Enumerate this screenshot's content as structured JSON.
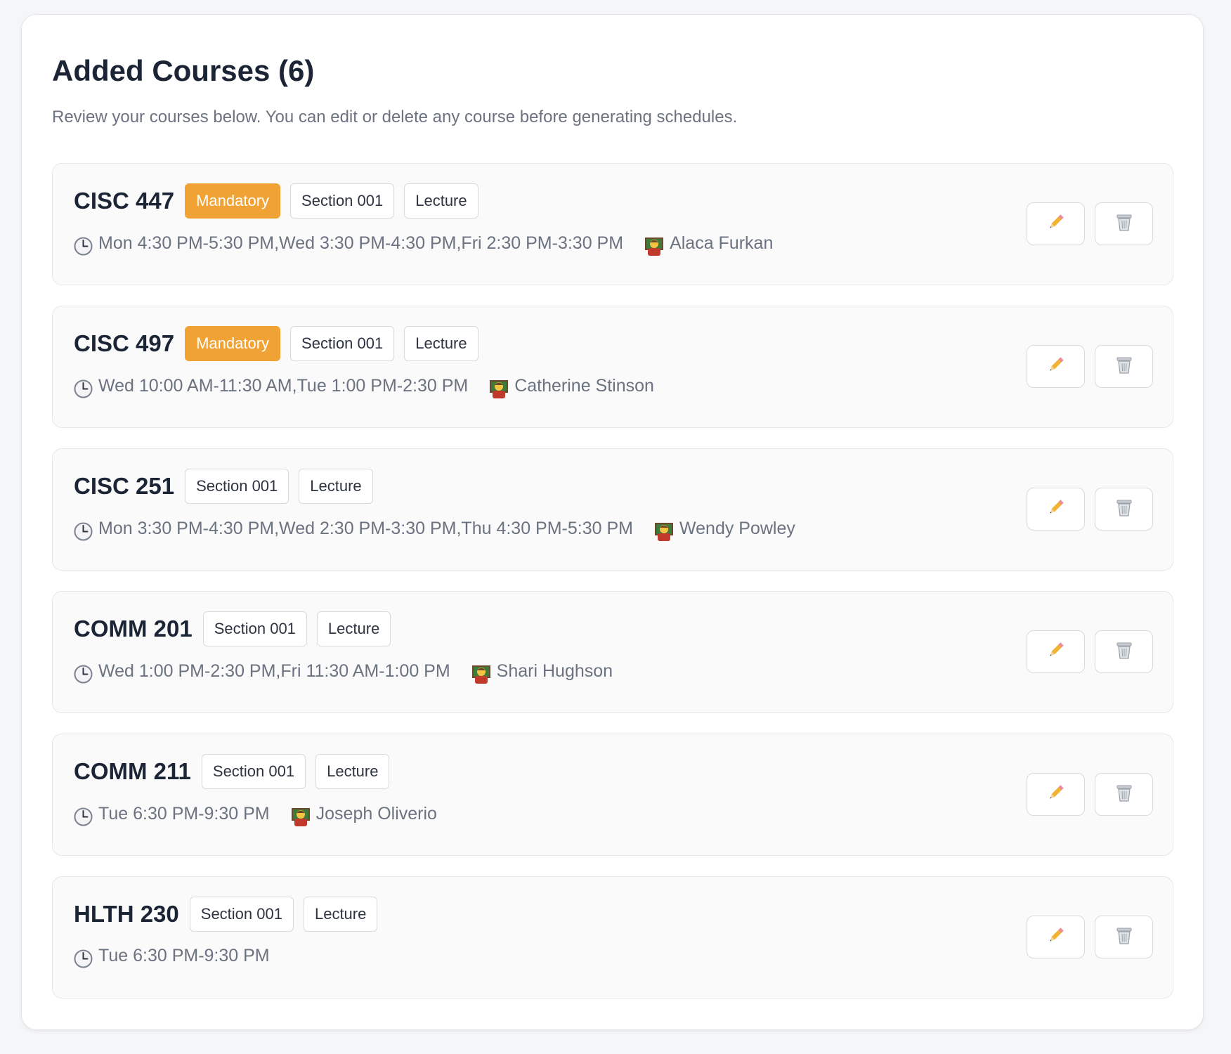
{
  "page": {
    "title": "Added Courses (6)",
    "subtitle": "Review your courses below. You can edit or delete any course before generating schedules."
  },
  "icons": {
    "time": "clock-icon",
    "instructor": "teacher-icon",
    "edit": "pencil-icon",
    "delete": "trash-icon"
  },
  "colors": {
    "mandatory_badge": "#f0a334",
    "title_text": "#1c2536",
    "muted_text": "#6b7280"
  },
  "courses": [
    {
      "code": "CISC 447",
      "mandatory": "Mandatory",
      "section": "Section 001",
      "type": "Lecture",
      "times": "Mon 4:30 PM-5:30 PM,Wed 3:30 PM-4:30 PM,Fri 2:30 PM-3:30 PM",
      "instructor": "Alaca Furkan"
    },
    {
      "code": "CISC 497",
      "mandatory": "Mandatory",
      "section": "Section 001",
      "type": "Lecture",
      "times": "Wed 10:00 AM-11:30 AM,Tue 1:00 PM-2:30 PM",
      "instructor": "Catherine Stinson"
    },
    {
      "code": "CISC 251",
      "section": "Section 001",
      "type": "Lecture",
      "times": "Mon 3:30 PM-4:30 PM,Wed 2:30 PM-3:30 PM,Thu 4:30 PM-5:30 PM",
      "instructor": "Wendy Powley"
    },
    {
      "code": "COMM 201",
      "section": "Section 001",
      "type": "Lecture",
      "times": "Wed 1:00 PM-2:30 PM,Fri 11:30 AM-1:00 PM",
      "instructor": "Shari Hughson"
    },
    {
      "code": "COMM 211",
      "section": "Section 001",
      "type": "Lecture",
      "times": "Tue 6:30 PM-9:30 PM",
      "instructor": "Joseph Oliverio"
    },
    {
      "code": "HLTH 230",
      "section": "Section 001",
      "type": "Lecture",
      "times": "Tue 6:30 PM-9:30 PM"
    }
  ]
}
